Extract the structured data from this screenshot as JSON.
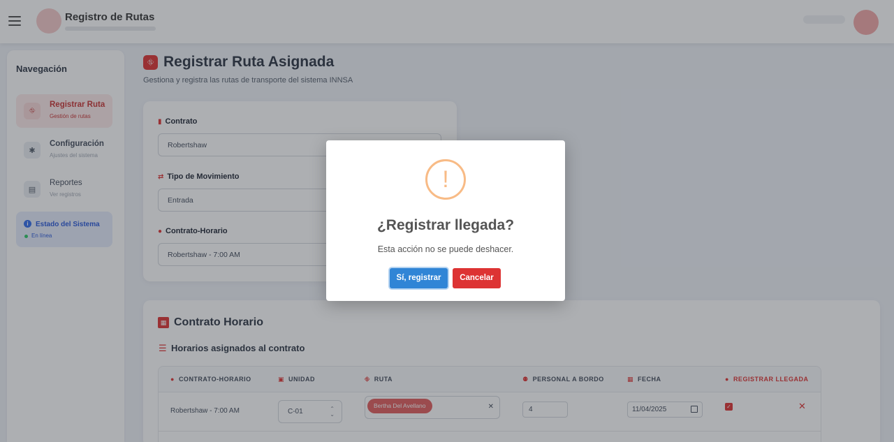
{
  "header": {
    "app_title": "Registro de Rutas",
    "menu_icon": "hamburger-icon"
  },
  "sidebar": {
    "title": "Navegación",
    "items": [
      {
        "label": "Registrar Ruta",
        "sub": "Gestión de rutas",
        "icon": "route-icon"
      },
      {
        "label": "Configuración",
        "sub": "Ajustes del sistema",
        "icon": "gear-icon"
      },
      {
        "label": "Reportes",
        "sub": "Ver registros",
        "icon": "file-icon"
      }
    ],
    "status": {
      "title": "Estado del Sistema",
      "value": "En línea"
    }
  },
  "page": {
    "title": "Registrar Ruta Asignada",
    "subtitle": "Gestiona y registra las rutas de transporte del sistema INNSA"
  },
  "form": {
    "contrato_label": "Contrato",
    "contrato_value": "Robertshaw",
    "movimiento_label": "Tipo de Movimiento",
    "movimiento_value": "Entrada",
    "horario_label": "Contrato-Horario",
    "horario_value": "Robertshaw - 7:00 AM"
  },
  "table_section": {
    "title": "Contrato Horario",
    "subtitle": "Horarios asignados al contrato",
    "columns": [
      "CONTRATO-HORARIO",
      "UNIDAD",
      "RUTA",
      "PERSONAL A BORDO",
      "FECHA",
      "REGISTRAR LLEGADA"
    ],
    "rows": [
      {
        "contrato_horario": "Robertshaw - 7:00 AM",
        "unidad": "C-01",
        "ruta": "Bertha Del Avellano",
        "personal": "4",
        "fecha": "11/04/2025",
        "registrar": true
      }
    ]
  },
  "modal": {
    "icon": "!",
    "title": "¿Registrar llegada?",
    "text": "Esta acción no se puede deshacer.",
    "confirm_label": "Sí, registrar",
    "cancel_label": "Cancelar"
  },
  "colors": {
    "accent": "#dc2626",
    "confirm": "#3085d6",
    "cancel": "#dd3333",
    "warning": "#f8bb86"
  }
}
